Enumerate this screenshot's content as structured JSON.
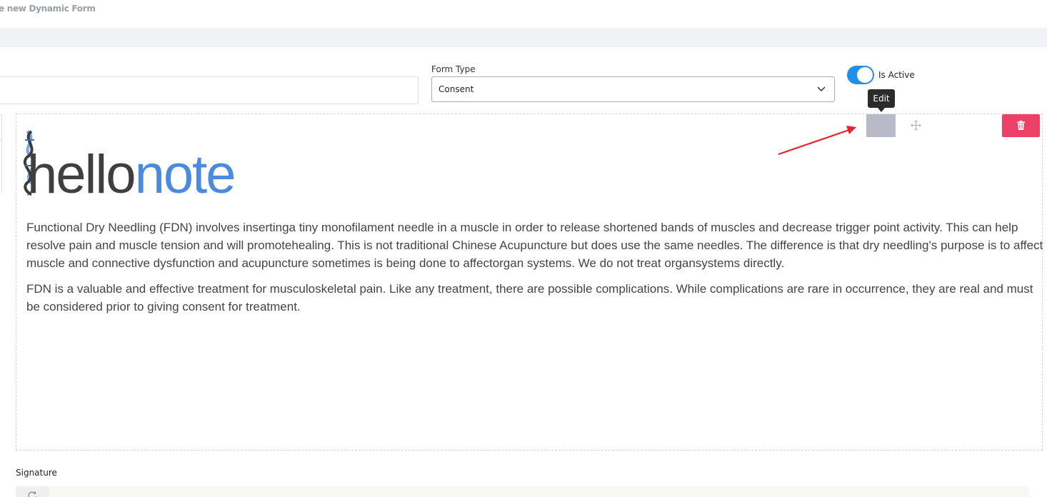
{
  "header": {
    "title": "e new Dynamic Form"
  },
  "form": {
    "name_value": "",
    "form_type": {
      "label": "Form Type",
      "value": "Consent"
    },
    "is_active": {
      "label": "Is Active",
      "on": true
    }
  },
  "block_toolbar": {
    "tooltip": "Edit",
    "icons": {
      "move": "move-icon",
      "delete": "trash-icon"
    },
    "colors": {
      "edit": "#b9bac7",
      "delete": "#ee3f66",
      "toggle": "#1f8fe8"
    }
  },
  "content": {
    "logo": {
      "text_hello": "hello",
      "text_note": "note",
      "colors": {
        "hello": "#3f3f3f",
        "note": "#4a8be0"
      }
    },
    "paragraphs": [
      "Functional Dry Needling (FDN) involves insertinga tiny monofilament needle in a muscle in order to release shortened bands of muscles and decrease trigger point activity. This can help resolve pain and muscle tension and will promotehealing. This is not traditional Chinese Acupuncture but does use the same needles. The difference is that dry needling's purpose is to affect muscle and connective dysfunction and acupuncture sometimes is being done to affectorgan systems. We do not treat organsystems directly.",
      "FDN is a valuable and effective treatment for musculoskeletal pain. Like any treatment, there are possible complications. While complications are rare in occurrence, they are real and must be considered prior to giving consent for treatment."
    ]
  },
  "signature": {
    "label": "Signature"
  }
}
